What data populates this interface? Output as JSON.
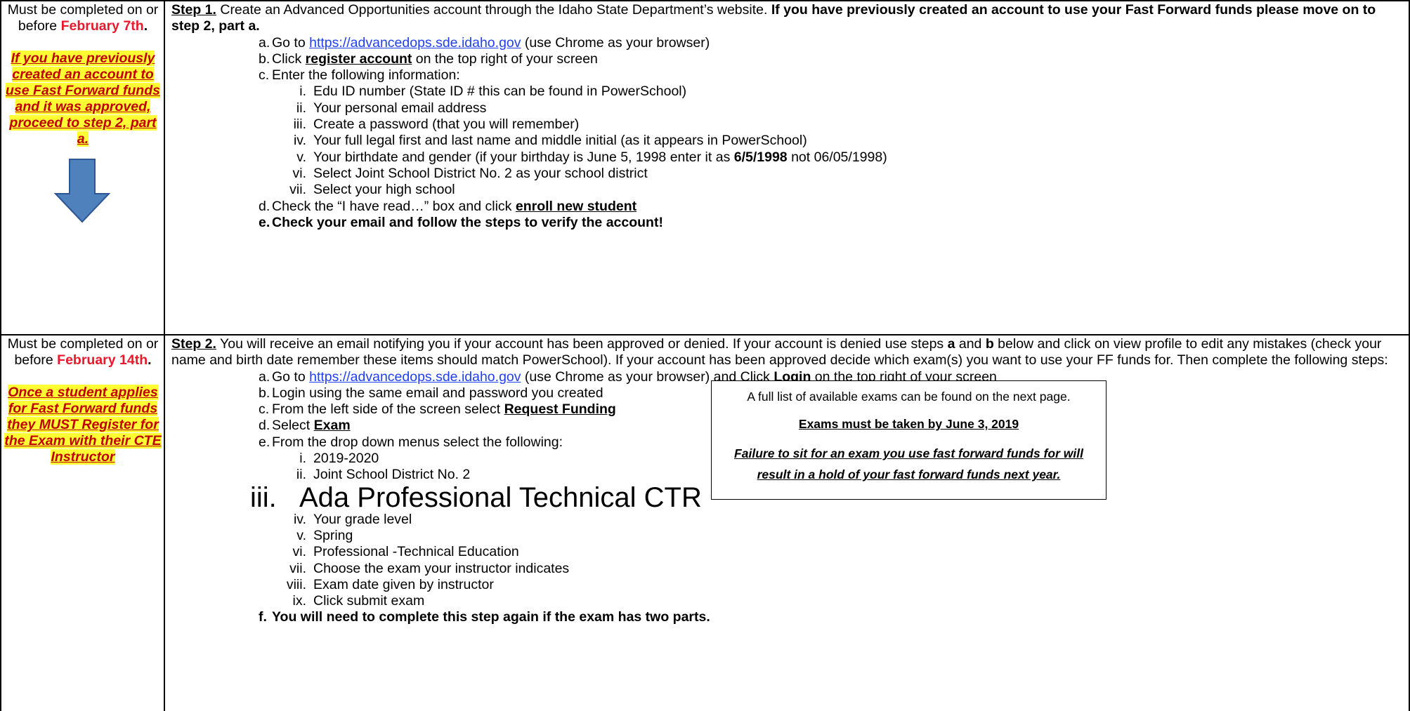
{
  "step1": {
    "deadline": {
      "prefix": "Must be completed on or before ",
      "date": "February 7th",
      "suffix": "."
    },
    "note": "If you have previously created an account to use Fast Forward funds and it was approved, proceed to step 2, part a.",
    "arrow_icon": "down-arrow-icon",
    "heading": "Step 1.",
    "intro": " Create an Advanced Opportunities account through the Idaho State Department’s website. ",
    "intro_bold": "If you have previously created an account to use your Fast Forward funds please move on to step 2, part a.",
    "items": [
      {
        "marker": "a.",
        "pre": "Go to ",
        "link": "https://advancedops.sde.idaho.gov",
        "post": "  (use Chrome as your browser)"
      },
      {
        "marker": "b.",
        "pre": "Click ",
        "strong": "register account",
        "post": " on the top right of your screen"
      },
      {
        "marker": "c.",
        "text": "Enter the following information:"
      }
    ],
    "subitems": [
      {
        "marker": "i.",
        "text": "Edu ID number (State ID # this can be found in PowerSchool)"
      },
      {
        "marker": "ii.",
        "text": "Your personal email address"
      },
      {
        "marker": "iii.",
        "text": "Create a password (that you will remember)"
      },
      {
        "marker": "iv.",
        "text": "Your full legal first and last name and middle initial (as it appears in PowerSchool)"
      },
      {
        "marker": "v.",
        "pre": "Your birthdate and gender (if your birthday is June 5, 1998 enter it as ",
        "strong": "6/5/1998",
        "post": " not 06/05/1998)"
      },
      {
        "marker": "vi.",
        "text": "Select Joint School District No. 2 as your school district"
      },
      {
        "marker": "vii.",
        "text": "Select your high school"
      }
    ],
    "item_d": {
      "marker": "d.",
      "pre": "Check the “I have read…” box and click ",
      "strong": "enroll new student"
    },
    "item_e": {
      "marker": "e.",
      "text": "Check your email and follow the steps to verify the account!"
    }
  },
  "step2": {
    "deadline": {
      "prefix": "Must be completed on or before ",
      "date": "February 14th",
      "suffix": "."
    },
    "note": "Once a student applies for Fast Forward funds they MUST Register for the Exam with their CTE Instructor",
    "heading": "Step 2.",
    "intro_1": "  You will receive an email notifying you if your account has been approved or denied. If your account is denied use steps ",
    "intro_a": "a",
    "intro_2": " and ",
    "intro_b": "b",
    "intro_3": " below and click on view profile to edit any mistakes (check your name and birth date remember these items should match PowerSchool). If your account has been approved decide which exam(s) you want to use your FF funds for. Then complete the following steps:",
    "items": [
      {
        "marker": "a.",
        "pre": "Go to ",
        "link": "https://advancedops.sde.idaho.gov",
        "mid": " (use Chrome as your browser) and Click ",
        "strong": "Login",
        "post": " on the top right of your screen"
      },
      {
        "marker": "b.",
        "text": "Login using the same email and password you created"
      },
      {
        "marker": "c.",
        "pre": "From the left side of the screen select ",
        "strong": "Request Funding"
      },
      {
        "marker": "d.",
        "pre": "Select ",
        "strong": "Exam"
      },
      {
        "marker": "e.",
        "text": "From the drop down menus select the following:"
      }
    ],
    "subitems": [
      {
        "marker": "i.",
        "text": "2019-2020"
      },
      {
        "marker": "ii.",
        "text": "Joint School District No. 2"
      },
      {
        "marker": "iii.",
        "text": "Ada Professional Technical CTR"
      },
      {
        "marker": "iv.",
        "text": "Your grade level"
      },
      {
        "marker": "v.",
        "text": "Spring"
      },
      {
        "marker": "vi.",
        "text": "Professional -Technical Education"
      },
      {
        "marker": "vii.",
        "text": "Choose the exam your instructor indicates"
      },
      {
        "marker": "viii.",
        "text": "Exam date given by instructor"
      },
      {
        "marker": "ix.",
        "text": "Click submit exam"
      }
    ],
    "item_f": {
      "marker": "f.",
      "text": "You will need to complete this step again if the exam has two parts."
    }
  },
  "notice": {
    "line1": "A full list of available exams can be found on the next page.",
    "line2": "Exams must be taken by June 3, 2019",
    "line3": "Failure to sit for an exam you use fast forward funds for will result in a hold of your fast forward funds next year."
  },
  "colors": {
    "deadline": "#e8192c",
    "highlight": "#ffff33",
    "note_text": "#c00000",
    "link": "#1f3ff0",
    "arrow": "#4f81bd"
  }
}
